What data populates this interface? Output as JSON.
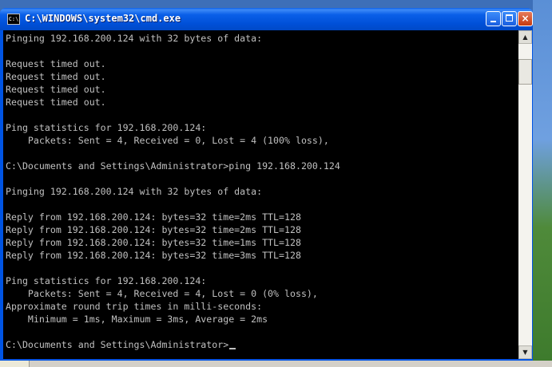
{
  "window": {
    "title": "C:\\WINDOWS\\system32\\cmd.exe",
    "icon_text": "C:\\",
    "controls": {
      "minimize": "minimize-icon",
      "maximize": "maximize-icon",
      "close": "×"
    }
  },
  "console": {
    "lines": [
      "Pinging 192.168.200.124 with 32 bytes of data:",
      "",
      "Request timed out.",
      "Request timed out.",
      "Request timed out.",
      "Request timed out.",
      "",
      "Ping statistics for 192.168.200.124:",
      "    Packets: Sent = 4, Received = 0, Lost = 4 (100% loss),",
      "",
      "C:\\Documents and Settings\\Administrator>ping 192.168.200.124",
      "",
      "Pinging 192.168.200.124 with 32 bytes of data:",
      "",
      "Reply from 192.168.200.124: bytes=32 time=2ms TTL=128",
      "Reply from 192.168.200.124: bytes=32 time=2ms TTL=128",
      "Reply from 192.168.200.124: bytes=32 time=1ms TTL=128",
      "Reply from 192.168.200.124: bytes=32 time=3ms TTL=128",
      "",
      "Ping statistics for 192.168.200.124:",
      "    Packets: Sent = 4, Received = 4, Lost = 0 (0% loss),",
      "Approximate round trip times in milli-seconds:",
      "    Minimum = 1ms, Maximum = 3ms, Average = 2ms",
      "",
      "C:\\Documents and Settings\\Administrator>"
    ]
  },
  "scrollbar": {
    "up": "▲",
    "down": "▼"
  },
  "colors": {
    "console_bg": "#000000",
    "console_fg": "#c0c0c0",
    "titlebar": "#0054e3"
  }
}
